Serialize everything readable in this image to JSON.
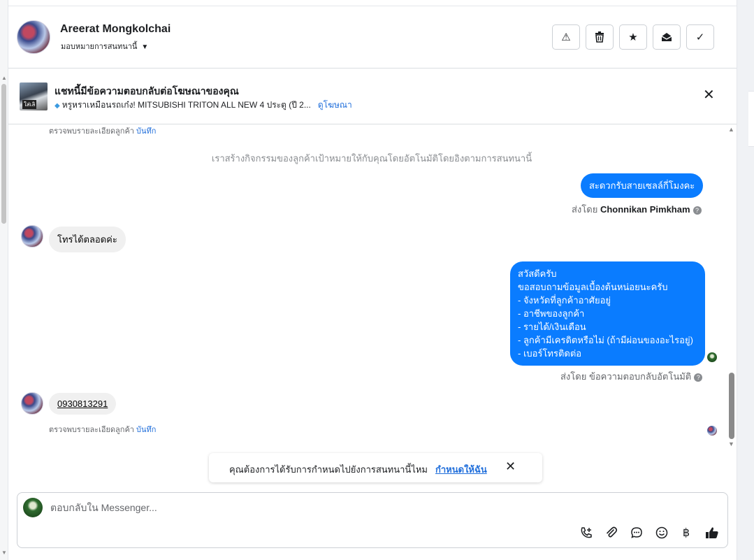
{
  "header": {
    "contact_name": "Areerat Mongkolchai",
    "assign_label": "มอบหมายการสนทนานี้",
    "actions": [
      {
        "name": "report-button",
        "icon": "warning-icon",
        "glyph": "⚠"
      },
      {
        "name": "delete-button",
        "icon": "trash-icon",
        "glyph": "🗑"
      },
      {
        "name": "star-button",
        "icon": "star-icon",
        "glyph": "★"
      },
      {
        "name": "mark-unread-button",
        "icon": "envelope-open-icon",
        "glyph": "✉"
      },
      {
        "name": "mark-done-button",
        "icon": "check-icon",
        "glyph": "✓"
      }
    ]
  },
  "ad": {
    "thumb_text": "ใส่เลิ",
    "title": "แชทนี้มีข้อความตอบกลับต่อโฆษณาของคุณ",
    "subtitle": "หรูหราเหมือนรถเก๋ง! MITSUBISHI TRITON ALL NEW 4 ประตู (ปี 2...",
    "view_link": "ดูโฆษณา",
    "close_glyph": "✕"
  },
  "messages": {
    "note_top": {
      "text": "ตรวจพบรายละเอียดลูกค้า",
      "link": "บันทึก"
    },
    "system_text": "เราสร้างกิจกรรมของลูกค้าเป้าหมายให้กับคุณโดยอัตโนมัติโดยอิงตามการสนทนานี้",
    "out1": {
      "text": "สะดวกรับสายเซลล์กี่โมงคะ",
      "sent_prefix": "ส่งโดย",
      "sent_by": "Chonnikan Pimkham"
    },
    "in1": {
      "text": "โทรได้ตลอดค่ะ"
    },
    "out2": {
      "lines": [
        "สวัสดีครับ",
        "ขอสอบถามข้อมูลเบื้องต้นหน่อยนะครับ",
        "- จังหวัดที่ลูกค้าอาศัยอยู่",
        "- อาชีพของลูกค้า",
        "- รายได้/เงินเดือน",
        "- ลูกค้ามีเครดิตหรือไม่ (ถ้ามีผ่อนของอะไรอยู่)",
        "- เบอร์โทรติดต่อ"
      ],
      "sent_prefix": "ส่งโดย",
      "sent_by": "ข้อความตอบกลับอัตโนมัติ"
    },
    "in2": {
      "text": "0930813291"
    },
    "note_bottom": {
      "text": "ตรวจพบรายละเอียดลูกค้า",
      "link": "บันทึก"
    },
    "help_glyph": "?"
  },
  "assign_toast": {
    "question": "คุณต้องการได้รับการกำหนดไปยังการสนทนานี้ไหม",
    "action": "กำหนดให้ฉัน",
    "close_glyph": "✕"
  },
  "composer": {
    "placeholder": "ตอบกลับใน Messenger...",
    "value": "",
    "tools": [
      {
        "name": "call-add-icon",
        "glyph": "📞"
      },
      {
        "name": "attach-icon",
        "glyph": "📎"
      },
      {
        "name": "saved-reply-icon",
        "glyph": "💬"
      },
      {
        "name": "emoji-icon",
        "glyph": "☺"
      },
      {
        "name": "payment-icon",
        "glyph": "฿"
      },
      {
        "name": "like-icon",
        "glyph": "👍"
      }
    ]
  }
}
